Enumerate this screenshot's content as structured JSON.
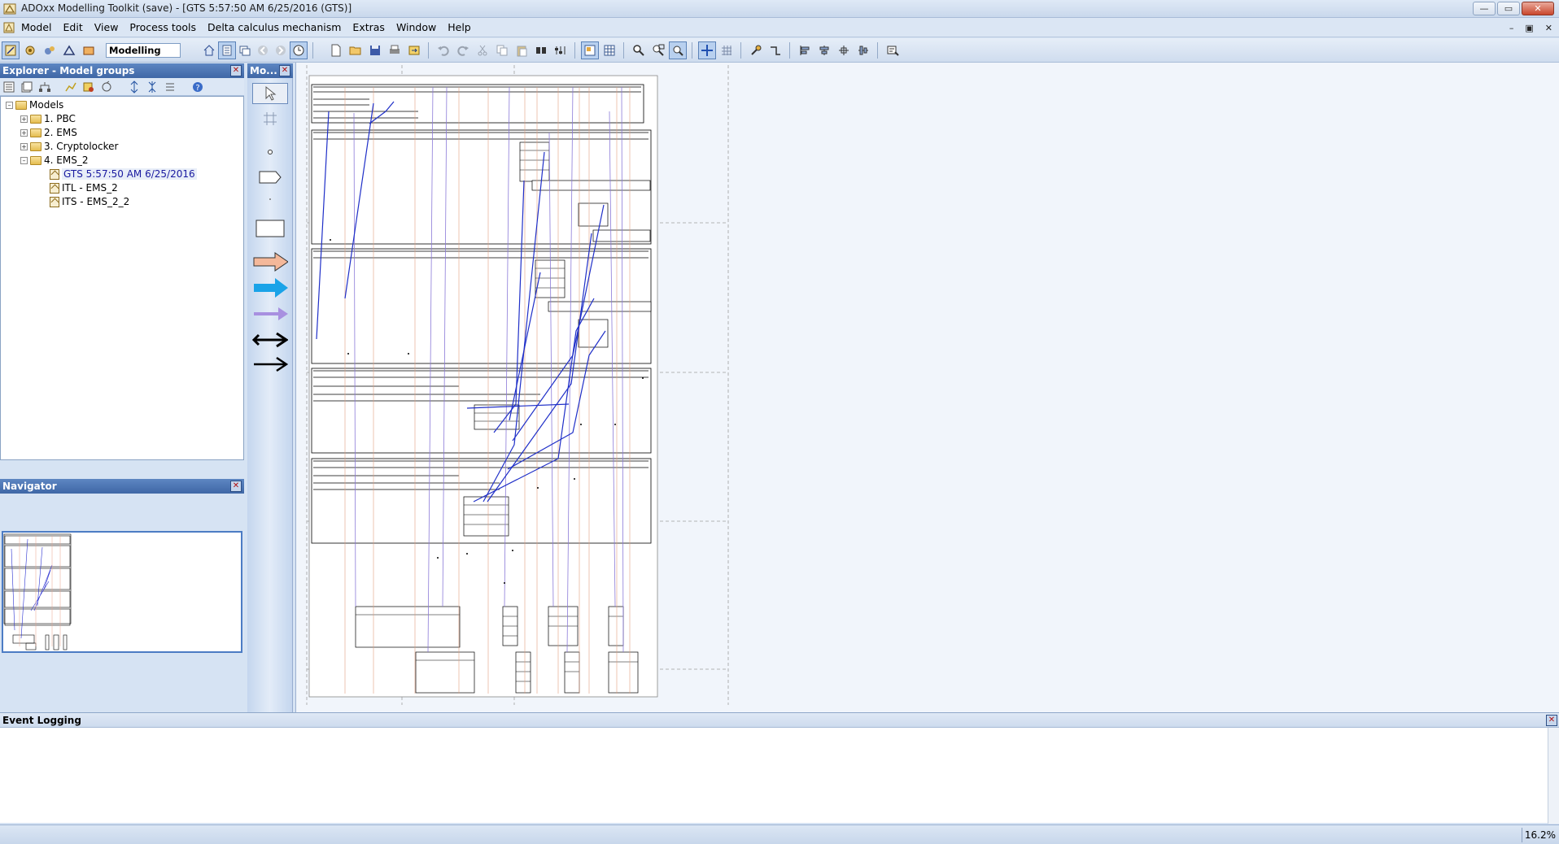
{
  "window": {
    "title": "ADOxx Modelling Toolkit (save) - [GTS 5:57:50 AM 6/25/2016 (GTS)]",
    "min": "—",
    "max": "▭",
    "close": "✕"
  },
  "menubar": {
    "items": [
      "Model",
      "Edit",
      "View",
      "Process tools",
      "Delta calculus mechanism",
      "Extras",
      "Window",
      "Help"
    ],
    "mdi_min": "–",
    "mdi_restore": "▣",
    "mdi_close": "✕"
  },
  "toolbar": {
    "mode_label": "Modelling"
  },
  "explorer": {
    "title": "Explorer - Model groups",
    "close": "✕",
    "tree": {
      "root": "Models",
      "groups": [
        {
          "label": "1. PBC",
          "expanded": false
        },
        {
          "label": "2. EMS",
          "expanded": false
        },
        {
          "label": "3. Cryptolocker",
          "expanded": false
        },
        {
          "label": "4. EMS_2",
          "expanded": true
        }
      ],
      "models": [
        {
          "label": "GTS 5:57:50 AM 6/25/2016",
          "selected": true
        },
        {
          "label": "ITL - EMS_2",
          "selected": false
        },
        {
          "label": "ITS - EMS_2_2",
          "selected": false
        }
      ]
    }
  },
  "navigator": {
    "title": "Navigator",
    "close": "✕"
  },
  "palette": {
    "title": "Mo...",
    "close": "✕",
    "items": [
      "pointer-tool",
      "swimlane-tool",
      "node-dot-tool",
      "event-shape-tool",
      "small-dot-tool",
      "rectangle-tool",
      "orange-arrow-tool",
      "blue-arrow-tool",
      "purple-arrow-tool",
      "black-bold-arrow-tool",
      "black-arrow-tool"
    ]
  },
  "colors": {
    "panel_header": "#3f67a6",
    "connector_blue": "#1f2fc8",
    "connector_orange": "#e0a080",
    "connector_purple": "#a890e0",
    "accent_blue_arrow": "#1aa3e8",
    "orange_arrow": "#f4b89a"
  },
  "event_log": {
    "title": "Event Logging"
  },
  "statusbar": {
    "zoom": "16.2%"
  }
}
